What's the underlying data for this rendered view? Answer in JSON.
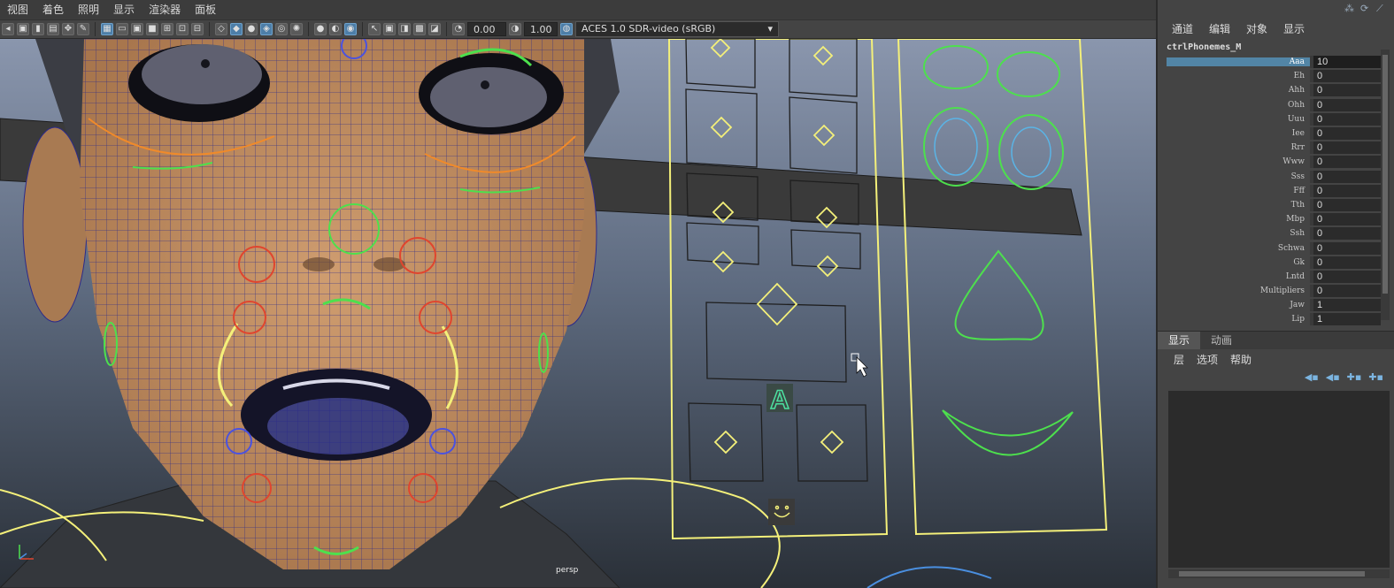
{
  "menubar": [
    "视图",
    "着色",
    "照明",
    "显示",
    "渲染器",
    "面板"
  ],
  "toolbar": {
    "exposure": "0.00",
    "gamma": "1.00",
    "colorspace": "ACES 1.0 SDR-video (sRGB)"
  },
  "viewport": {
    "camera_label": "persp",
    "phoneme_badge": "A"
  },
  "channel_box": {
    "menu": [
      "通道",
      "编辑",
      "对象",
      "显示"
    ],
    "node_name": "ctrlPhonemes_M",
    "channels": [
      {
        "name": "Aaa",
        "value": "10",
        "selected": true
      },
      {
        "name": "Eh",
        "value": "0"
      },
      {
        "name": "Ahh",
        "value": "0"
      },
      {
        "name": "Ohh",
        "value": "0"
      },
      {
        "name": "Uuu",
        "value": "0"
      },
      {
        "name": "Iee",
        "value": "0"
      },
      {
        "name": "Rrr",
        "value": "0"
      },
      {
        "name": "Www",
        "value": "0"
      },
      {
        "name": "Sss",
        "value": "0"
      },
      {
        "name": "Fff",
        "value": "0"
      },
      {
        "name": "Tth",
        "value": "0"
      },
      {
        "name": "Mbp",
        "value": "0"
      },
      {
        "name": "Ssh",
        "value": "0"
      },
      {
        "name": "Schwa",
        "value": "0"
      },
      {
        "name": "Gk",
        "value": "0"
      },
      {
        "name": "Lntd",
        "value": "0"
      },
      {
        "name": "Multipliers",
        "value": "0"
      },
      {
        "name": "Jaw",
        "value": "1"
      },
      {
        "name": "Lip",
        "value": "1"
      }
    ]
  },
  "layer_editor": {
    "tabs": [
      "显示",
      "动画"
    ],
    "menu": [
      "层",
      "选项",
      "帮助"
    ]
  },
  "icons": [
    "axis-gizmo-icon",
    "mouse-cursor-icon",
    "smiley-control-icon"
  ],
  "colors": {
    "selection_blue": "#5285a6",
    "skin": "#c49468",
    "wireframe": "#2c2a8a",
    "ctrl_yellow": "#f4f07a",
    "ctrl_green": "#4de04d",
    "ctrl_red": "#e0452e",
    "ctrl_blue": "#4a52e0"
  }
}
